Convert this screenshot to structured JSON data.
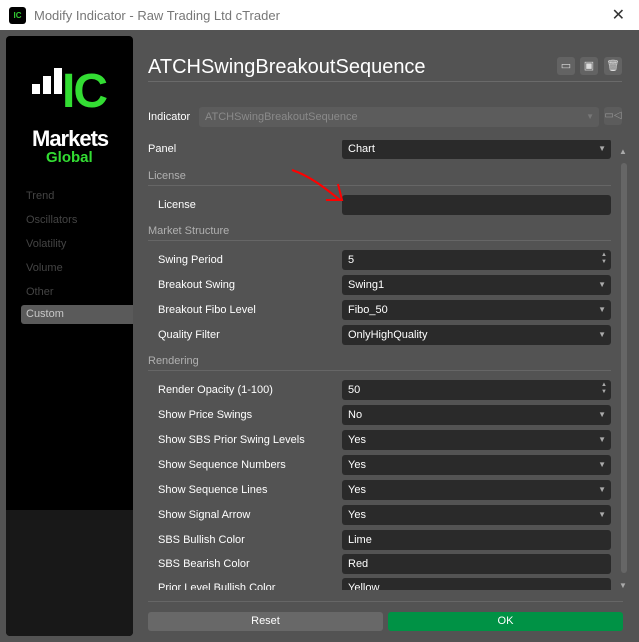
{
  "window": {
    "title": "Modify Indicator - Raw Trading Ltd cTrader",
    "close": "✕"
  },
  "logo": {
    "ic": "IC",
    "markets": "Markets",
    "global": "Global"
  },
  "sidebar": {
    "items": [
      {
        "label": "Trend"
      },
      {
        "label": "Oscillators"
      },
      {
        "label": "Volatility"
      },
      {
        "label": "Volume"
      },
      {
        "label": "Other"
      },
      {
        "label": "Custom",
        "active": true
      }
    ]
  },
  "header": {
    "title": "ATCHSwingBreakoutSequence",
    "icons": [
      "folder-open-icon",
      "save-icon",
      "trash-icon"
    ]
  },
  "indicator": {
    "label": "Indicator",
    "value": "ATCHSwingBreakoutSequence"
  },
  "panel": {
    "label": "Panel",
    "value": "Chart"
  },
  "sections": [
    {
      "title": "License",
      "params": [
        {
          "label": "License",
          "value": "",
          "type": "text"
        }
      ]
    },
    {
      "title": "Market Structure",
      "params": [
        {
          "label": "Swing Period",
          "value": "5",
          "type": "number"
        },
        {
          "label": "Breakout Swing",
          "value": "Swing1",
          "type": "select"
        },
        {
          "label": "Breakout Fibo Level",
          "value": "Fibo_50",
          "type": "select"
        },
        {
          "label": "Quality Filter",
          "value": "OnlyHighQuality",
          "type": "select"
        }
      ]
    },
    {
      "title": "Rendering",
      "params": [
        {
          "label": "Render Opacity (1-100)",
          "value": "50",
          "type": "number"
        },
        {
          "label": "Show Price Swings",
          "value": "No",
          "type": "select"
        },
        {
          "label": "Show SBS Prior Swing Levels",
          "value": "Yes",
          "type": "select"
        },
        {
          "label": "Show Sequence Numbers",
          "value": "Yes",
          "type": "select"
        },
        {
          "label": "Show Sequence Lines",
          "value": "Yes",
          "type": "select"
        },
        {
          "label": "Show Signal Arrow",
          "value": "Yes",
          "type": "select"
        },
        {
          "label": "SBS Bullish Color",
          "value": "Lime",
          "type": "text"
        },
        {
          "label": "SBS Bearish Color",
          "value": "Red",
          "type": "text"
        },
        {
          "label": "Prior Level Bullish Color",
          "value": "Yellow",
          "type": "text"
        }
      ]
    }
  ],
  "footer": {
    "reset": "Reset",
    "ok": "OK"
  },
  "colors": {
    "accent": "#009245",
    "brand_green": "#33dd33",
    "annotation_arrow": "#ff0000"
  }
}
